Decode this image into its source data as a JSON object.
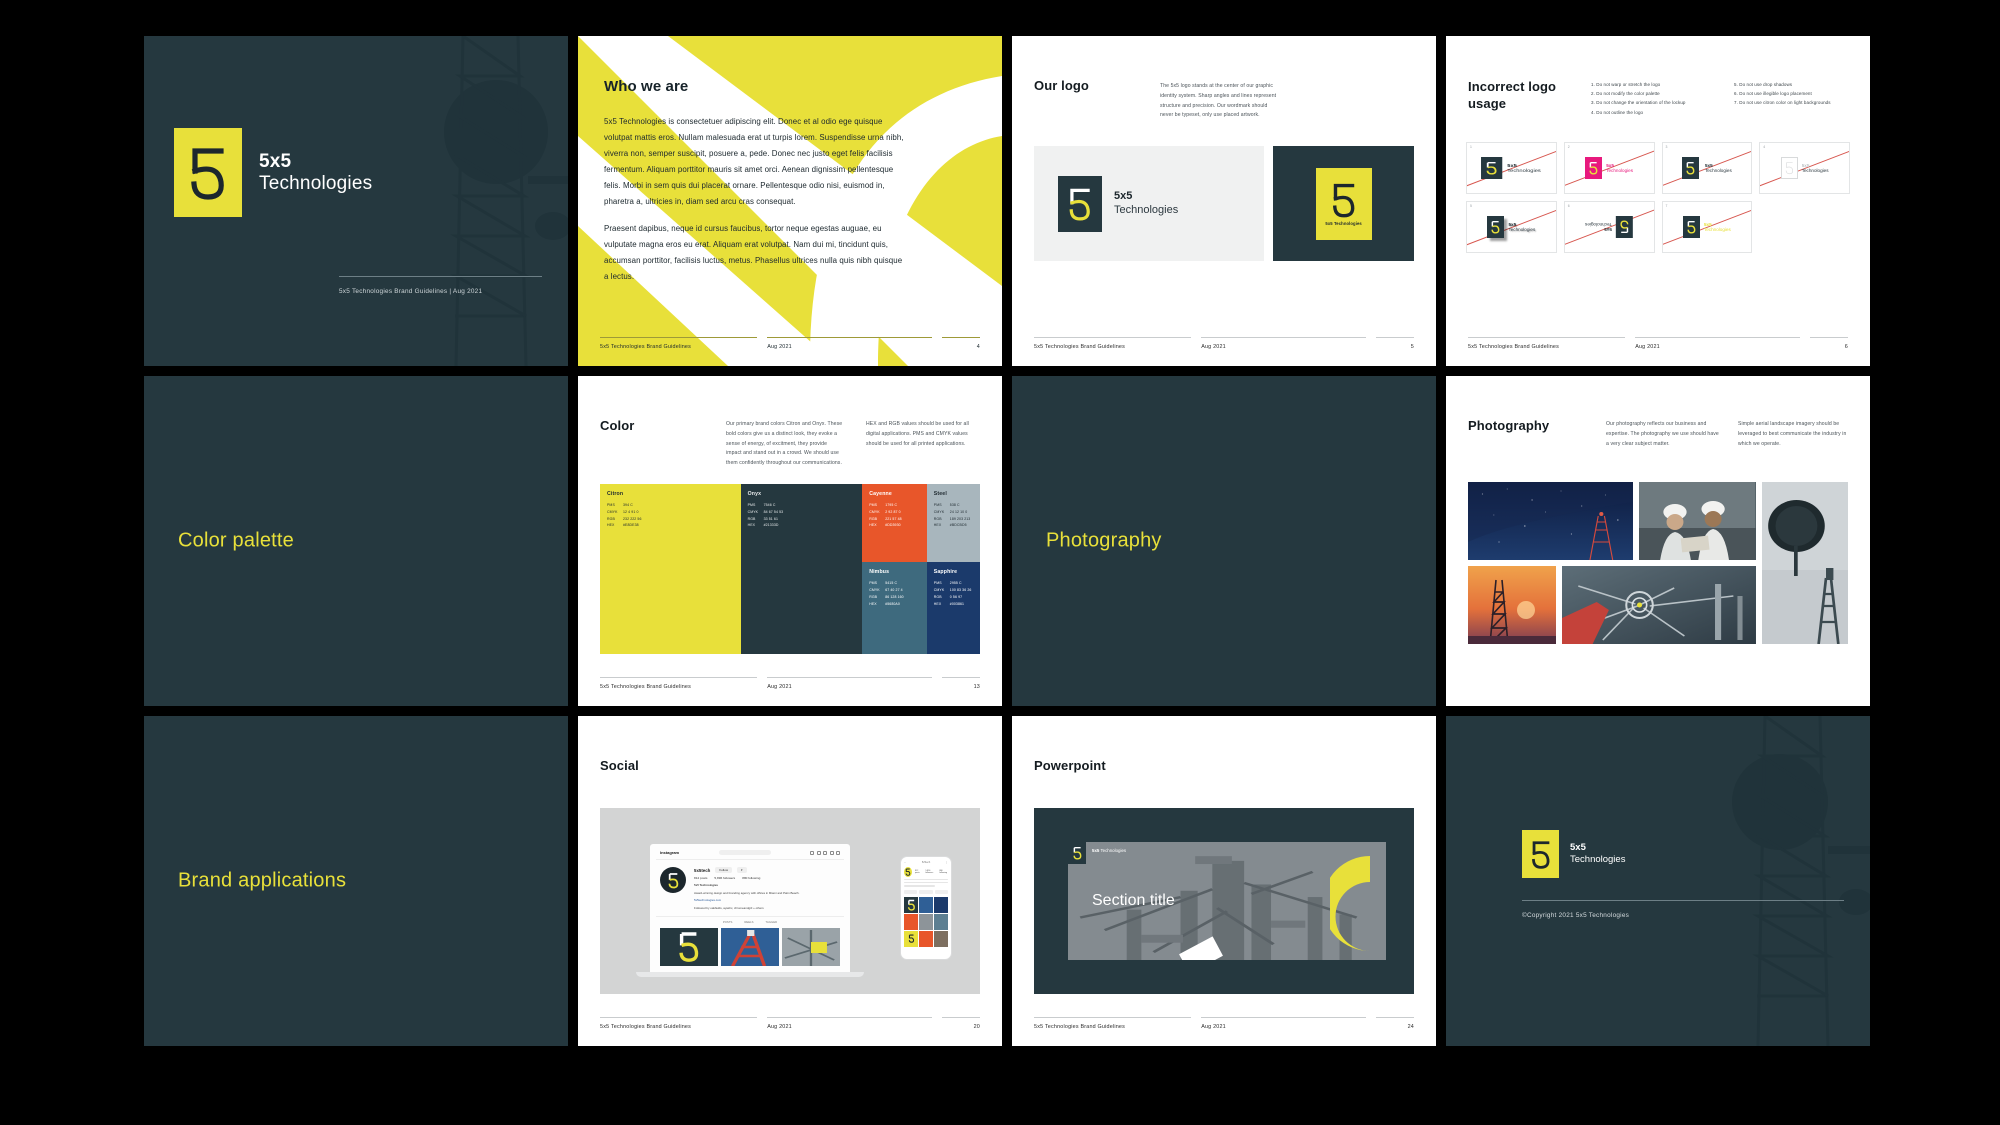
{
  "brand": {
    "name_line1": "5x5",
    "name_line2": "Technologies",
    "name_inline": "5x5 Technologies",
    "colors": {
      "citron": "#e8e03a",
      "onyx": "#25383f",
      "cayenne": "#e8562a",
      "steel": "#a8b6bd",
      "nimbus": "#3e6a7e",
      "sapphire": "#1b3a6b",
      "page_background": "#000000",
      "error_magenta": "#e8197d",
      "strike_red": "#d7564e"
    }
  },
  "footer": {
    "left": "5x5 Technologies Brand Guidelines",
    "middle": "Aug 2021"
  },
  "slides": {
    "cover": {
      "name_line1": "5x5",
      "name_line2": "Technologies",
      "footer_text": "5x5 Technologies Brand Guidelines  |  Aug 2021"
    },
    "who_we_are": {
      "title": "Who we are",
      "paragraph1": "5x5 Technologies is consectetuer adipiscing elit. Donec et al odio ege quisque volutpat mattis eros. Nullam malesuada erat ut turpis lorem. Suspendisse urna nibh, viverra non, semper suscipit, posuere a, pede. Donec nec justo eget felis facilisis fermentum. Aliquam porttitor mauris sit amet orci. Aenean dignissim pellentesque felis. Morbi in sem quis dui placerat ornare. Pellentesque odio nisi, euismod in, pharetra a, ultricies in, diam sed arcu cras consequat.",
      "paragraph2": "Praesent dapibus, neque id cursus faucibus, tortor neque egestas auguae, eu vulputate magna eros eu erat. Aliquam erat volutpat. Nam dui mi, tincidunt quis, accumsan porttitor, facilisis luctus, metus. Phasellus ultrices nulla quis nibh quisque a lectus.",
      "page": "4"
    },
    "our_logo": {
      "title": "Our logo",
      "note": "The 5x5 logo stands at the center of our graphic identity system. Sharp angles and lines represent structure and precision. Our wordmark should never be typeset, only use placed artwork.",
      "lockup_word1": "5x5",
      "lockup_word2": "Technologies",
      "stacked_sub": "5x5 Technologies",
      "page": "5"
    },
    "incorrect_logo": {
      "title_line1": "Incorrect logo",
      "title_line2": "usage",
      "rules_col1": [
        "1. Do not warp or stretch the logo",
        "2. Do not modify the color palette",
        "3. Do not change the orientation of the lockup",
        "4. Do not outline the logo"
      ],
      "rules_col2": [
        "5. Do not use drop shadows",
        "6. Do not use illegible logo placement",
        "7. Do not use citron color on light backgrounds"
      ],
      "cards": [
        {
          "num": "1",
          "word1": "5x5",
          "word2": "Technologies"
        },
        {
          "num": "2",
          "word1": "5x5",
          "word2": "Technologies"
        },
        {
          "num": "3",
          "word1": "5x5",
          "word2": "Technologies"
        },
        {
          "num": "4",
          "word1": "5x5",
          "word2": "Technologies"
        },
        {
          "num": "5",
          "word1": "5x5",
          "word2": "Technologies"
        },
        {
          "num": "6",
          "word1": "5x5",
          "word2": "Technologies"
        },
        {
          "num": "7",
          "word1": "5x5",
          "word2": "Technologies"
        }
      ],
      "page": "6"
    },
    "color_palette_section": {
      "title": "Color palette"
    },
    "color": {
      "title": "Color",
      "note1": "Our primary brand colors Citron and Onyx. These bold colors give us a distinct look, they evoke a sense of energy, of excitment, they provide impact and stand out in a crowd. We should use them confidently throughout our communications.",
      "note2": "HEX and RGB values should be used for all digital applications. PMS and CMYK values should be used for all printed applications.",
      "spec_keys": [
        "PMS",
        "CMYK",
        "RGB",
        "HEX"
      ],
      "swatches": [
        {
          "name": "Citron",
          "pms": "394 C",
          "cmyk": "12  4  91  0",
          "rgb": "232  222  56",
          "hex": "#E8DE38"
        },
        {
          "name": "Onyx",
          "pms": "7546 C",
          "cmyk": "84  67  54  53",
          "rgb": "33  51  61",
          "hex": "#21333D"
        },
        {
          "name": "Cayenne",
          "pms": "1795 C",
          "cmyk": "2  92  87  0",
          "rgb": "221  57  48",
          "hex": "#DD3930"
        },
        {
          "name": "Steel",
          "pms": "538 C",
          "cmyk": "24  12  10  0",
          "rgb": "189  203  213",
          "hex": "#BDCBD5"
        },
        {
          "name": "Nimbus",
          "pms": "5415 C",
          "cmyk": "67  40  27  4",
          "rgb": "86  128  160",
          "hex": "#5680A0"
        },
        {
          "name": "Sapphire",
          "pms": "2955 C",
          "cmyk": "100  83  36  26",
          "rgb": "0  56  97",
          "hex": "#003861"
        }
      ],
      "page": "13"
    },
    "photography_section": {
      "title": "Photography"
    },
    "photography": {
      "title": "Photography",
      "note1": "Our photography reflects our business and expertise. The photography we use should have a very clear subject matter.",
      "note2": "Simple aerial landscape imagery should be leveraged to best communicate the industry in which we operate.",
      "images": [
        "night-sky-tower-photo",
        "workers-hardhats-photo",
        "satellite-dish-photo",
        "sunset-tower-photo",
        "antenna-rig-photo"
      ]
    },
    "brand_applications_section": {
      "title": "Brand applications"
    },
    "social": {
      "title": "Social",
      "instagram": {
        "logo": "Instagram",
        "handle": "5x5tech",
        "follow_button": "Follow",
        "message_button": "▾",
        "stats": [
          "812 posts",
          "5,896 followers",
          "880 following"
        ],
        "display_name": "5x5 Technologies",
        "bio": "Award-winning design and branding agency with offices in Miami and Palm Beach.",
        "link": "5x5technologies.com",
        "followed_by": "Followed by oakfields, ayashx, chromeandgirl + others",
        "tabs": [
          "POSTS",
          "REELS",
          "TAGGED"
        ]
      },
      "page": "20"
    },
    "powerpoint": {
      "title": "Powerpoint",
      "slide_brand_bold": "5x5",
      "slide_brand_rest": " Technologies",
      "slide_title": "Section title",
      "page": "24"
    },
    "closing": {
      "name_line1": "5x5",
      "name_line2": "Technologies",
      "copyright": "©Copyright 2021 5x5 Technologies"
    }
  }
}
